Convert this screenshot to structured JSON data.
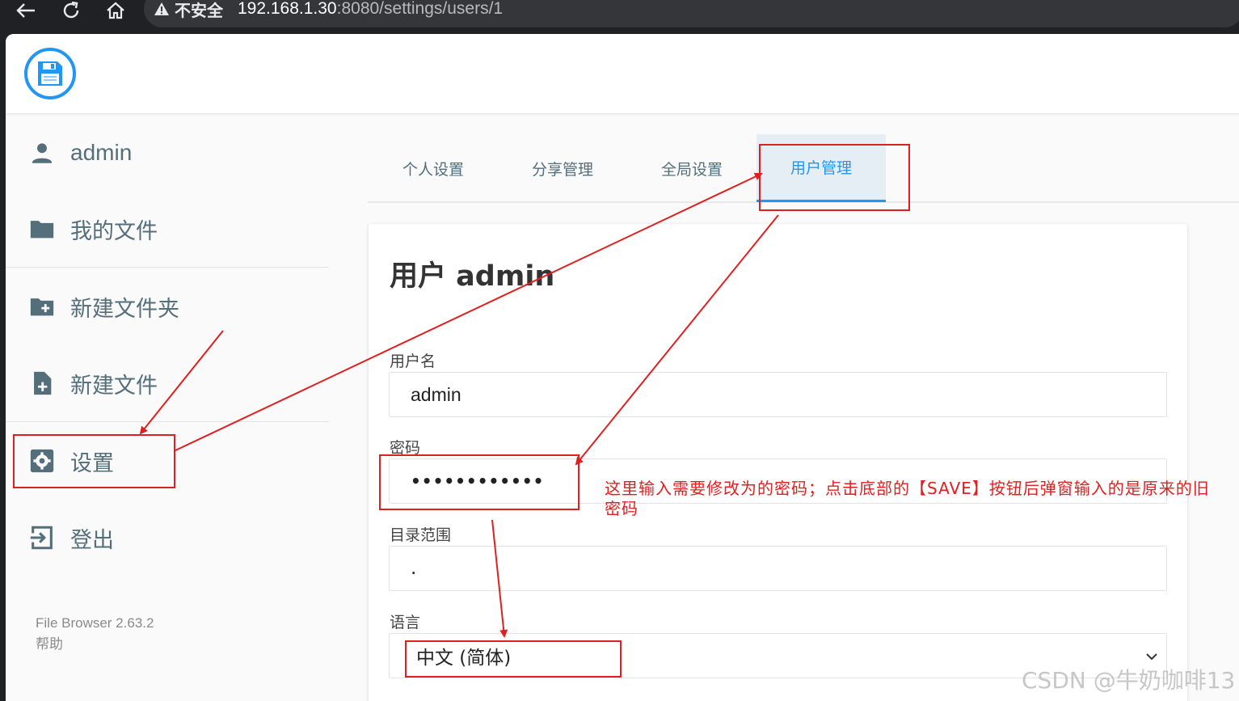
{
  "browser": {
    "security_label": "不安全",
    "url_host": "192.168.1.30",
    "url_rest": ":8080/settings/users/1"
  },
  "sidebar": {
    "user": "admin",
    "items": [
      {
        "label": "我的文件",
        "icon": "folder-icon"
      },
      {
        "label": "新建文件夹",
        "icon": "create-folder-icon"
      },
      {
        "label": "新建文件",
        "icon": "note-add-icon"
      },
      {
        "label": "设置",
        "icon": "settings-icon"
      },
      {
        "label": "登出",
        "icon": "logout-icon"
      }
    ],
    "version": "File Browser 2.63.2",
    "help": "帮助"
  },
  "tabs": [
    {
      "label": "个人设置",
      "active": false
    },
    {
      "label": "分享管理",
      "active": false
    },
    {
      "label": "全局设置",
      "active": false
    },
    {
      "label": "用户管理",
      "active": true
    }
  ],
  "form": {
    "title": "用户 admin",
    "username_label": "用户名",
    "username_value": "admin",
    "password_label": "密码",
    "password_value": "••••••••••••",
    "scope_label": "目录范围",
    "scope_value": ".",
    "language_label": "语言",
    "language_value": "中文 (简体)"
  },
  "annotation": {
    "text": "这里输入需要修改为的密码；点击底部的【SAVE】按钮后弹窗输入的是原来的旧密码",
    "color": "#e02020"
  },
  "watermark": "CSDN @牛奶咖啡13",
  "colors": {
    "accent": "#2196f3",
    "sidebar_text": "#546e7a",
    "annotation_red": "#e02020"
  }
}
